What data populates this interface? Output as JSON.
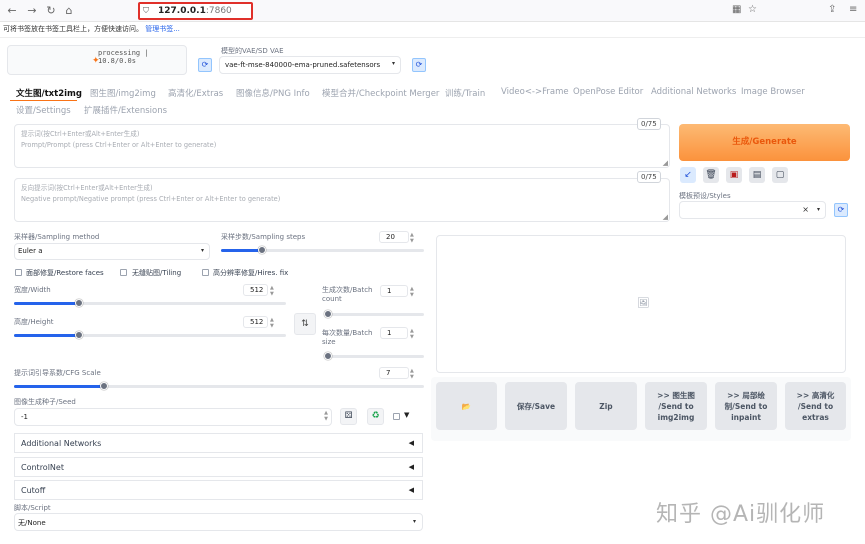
{
  "browser": {
    "url_host": "127.0.0.1",
    "url_port": ":7860",
    "bookmark_hint": "可将书签放在书签工具栏上，方便快速访问。",
    "bookmark_link": "管理书签..."
  },
  "top": {
    "progress_text": "processing | 10.8/0.0s",
    "vae_label": "模型的VAE/SD VAE",
    "vae_value": "vae-ft-mse-840000-ema-pruned.safetensors"
  },
  "tabs": [
    "文生图/txt2img",
    "图生图/img2img",
    "高清化/Extras",
    "图像信息/PNG Info",
    "模型合并/Checkpoint Merger",
    "训练/Train",
    "Video<->Frame",
    "OpenPose Editor",
    "Additional Networks",
    "Image Browser",
    "设置/Settings",
    "扩展插件/Extensions"
  ],
  "prompt": {
    "placeholder_1": "提示词(按Ctrl+Enter或Alt+Enter生成)",
    "placeholder_2": "Prompt/Prompt (press Ctrl+Enter or Alt+Enter to generate)",
    "counter": "0/75"
  },
  "negative": {
    "placeholder_1": "反向提示词(按Ctrl+Enter或Alt+Enter生成)",
    "placeholder_2": "Negative prompt/Negative prompt (press Ctrl+Enter or Alt+Enter to generate)",
    "counter": "0/75"
  },
  "generate_label": "生成/Generate",
  "styles_label": "模板预设/Styles",
  "sampling": {
    "method_label": "采样器/Sampling method",
    "method_value": "Euler a",
    "steps_label": "采样步数/Sampling steps",
    "steps_value": "20",
    "steps_fraction": 0.2
  },
  "checkboxes": [
    "面部修复/Restore faces",
    "无缝贴图/Tiling",
    "高分辨率修复/Hires. fix"
  ],
  "width": {
    "label": "宽度/Width",
    "value": "512",
    "fraction": 0.24
  },
  "height": {
    "label": "高度/Height",
    "value": "512",
    "fraction": 0.24
  },
  "batch_count": {
    "label_1": "生成次数/Batch",
    "label_2": "count",
    "value": "1"
  },
  "batch_size": {
    "label_1": "每次数量/Batch",
    "label_2": "size",
    "value": "1"
  },
  "cfg": {
    "label": "提示词引导系数/CFG Scale",
    "value": "7",
    "fraction": 0.22
  },
  "seed": {
    "label": "图像生成种子/Seed",
    "value": "-1"
  },
  "accordions": [
    "Additional Networks",
    "ControlNet",
    "Cutoff"
  ],
  "script": {
    "label": "脚本/Script",
    "value": "无/None"
  },
  "output_buttons": {
    "folder": "📂",
    "save": "保存/Save",
    "zip": "Zip",
    "send_img2img": [
      ">> 图生图",
      "/Send to",
      "img2img"
    ],
    "send_inpaint": [
      ">> 局部绘",
      "制/Send to",
      "inpaint"
    ],
    "send_extras": [
      ">> 高清化",
      "/Send to",
      "extras"
    ]
  },
  "watermark": "知乎 @Ai驯化师"
}
